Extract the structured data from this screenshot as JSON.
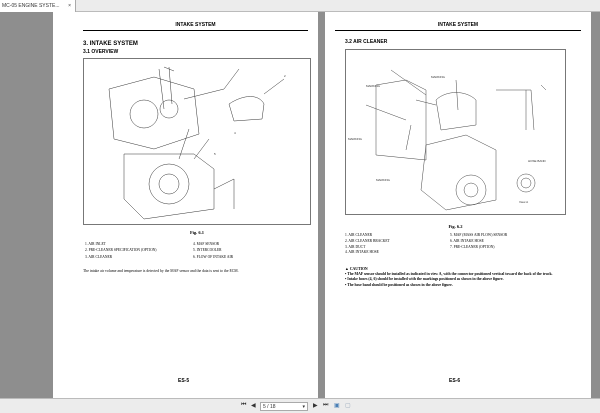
{
  "tab": {
    "title": "MC-05 ENGINE SYSTE...",
    "close": "×"
  },
  "left_page": {
    "header": "INTAKE SYSTEM",
    "section": "3.   INTAKE SYSTEM",
    "subsection": "3.1    OVERVIEW",
    "figure_caption": "Fig. 6.1",
    "legend_col1": [
      "1.  AIR INLET",
      "2.  PRE-CLEANER SPECIFICATION (OPTION)",
      "3.  AIR CLEANER"
    ],
    "legend_col2": [
      "4.  MAF SENSOR",
      "5.  INTERCOOLER",
      "6.  FLOW OF INTAKE AIR"
    ],
    "paragraph": "The intake air volume and temperature is detected by the MAF sensor and the data is sent to the ECM.",
    "footer": "ES-5"
  },
  "right_page": {
    "header": "INTAKE SYSTEM",
    "subsection": "3.2    AIR CLEANER",
    "figure_labels": {
      "marking": "MARKING",
      "hose_band": "HOSE BAND",
      "view_a": "View A"
    },
    "figure_caption": "Fig. 6.2",
    "legend_col1": [
      "1.  AIR CLEANER",
      "2.  AIR CLEANER BRACKET",
      "3.  AIR DUCT",
      "4.  AIR INTAKE HOSE"
    ],
    "legend_col2": [
      "5.  MAF (MASS AIR FLOW) SENSOR",
      "6.  AIR INTAKE HOSE",
      "7.  PRE-CLEANER (OPTION)"
    ],
    "caution_title": "CAUTION",
    "caution_items": [
      "The MAF sensor should be installed as indicated in view A, with the connector positioned vertical toward the back of the truck.",
      "Intake hoses (4, 6) should be installed with the markings positioned as shown in the above figure.",
      "The hose band should be positioned as shown in the above figure."
    ],
    "footer": "ES-6"
  },
  "toolbar": {
    "page": "5 / 18"
  }
}
